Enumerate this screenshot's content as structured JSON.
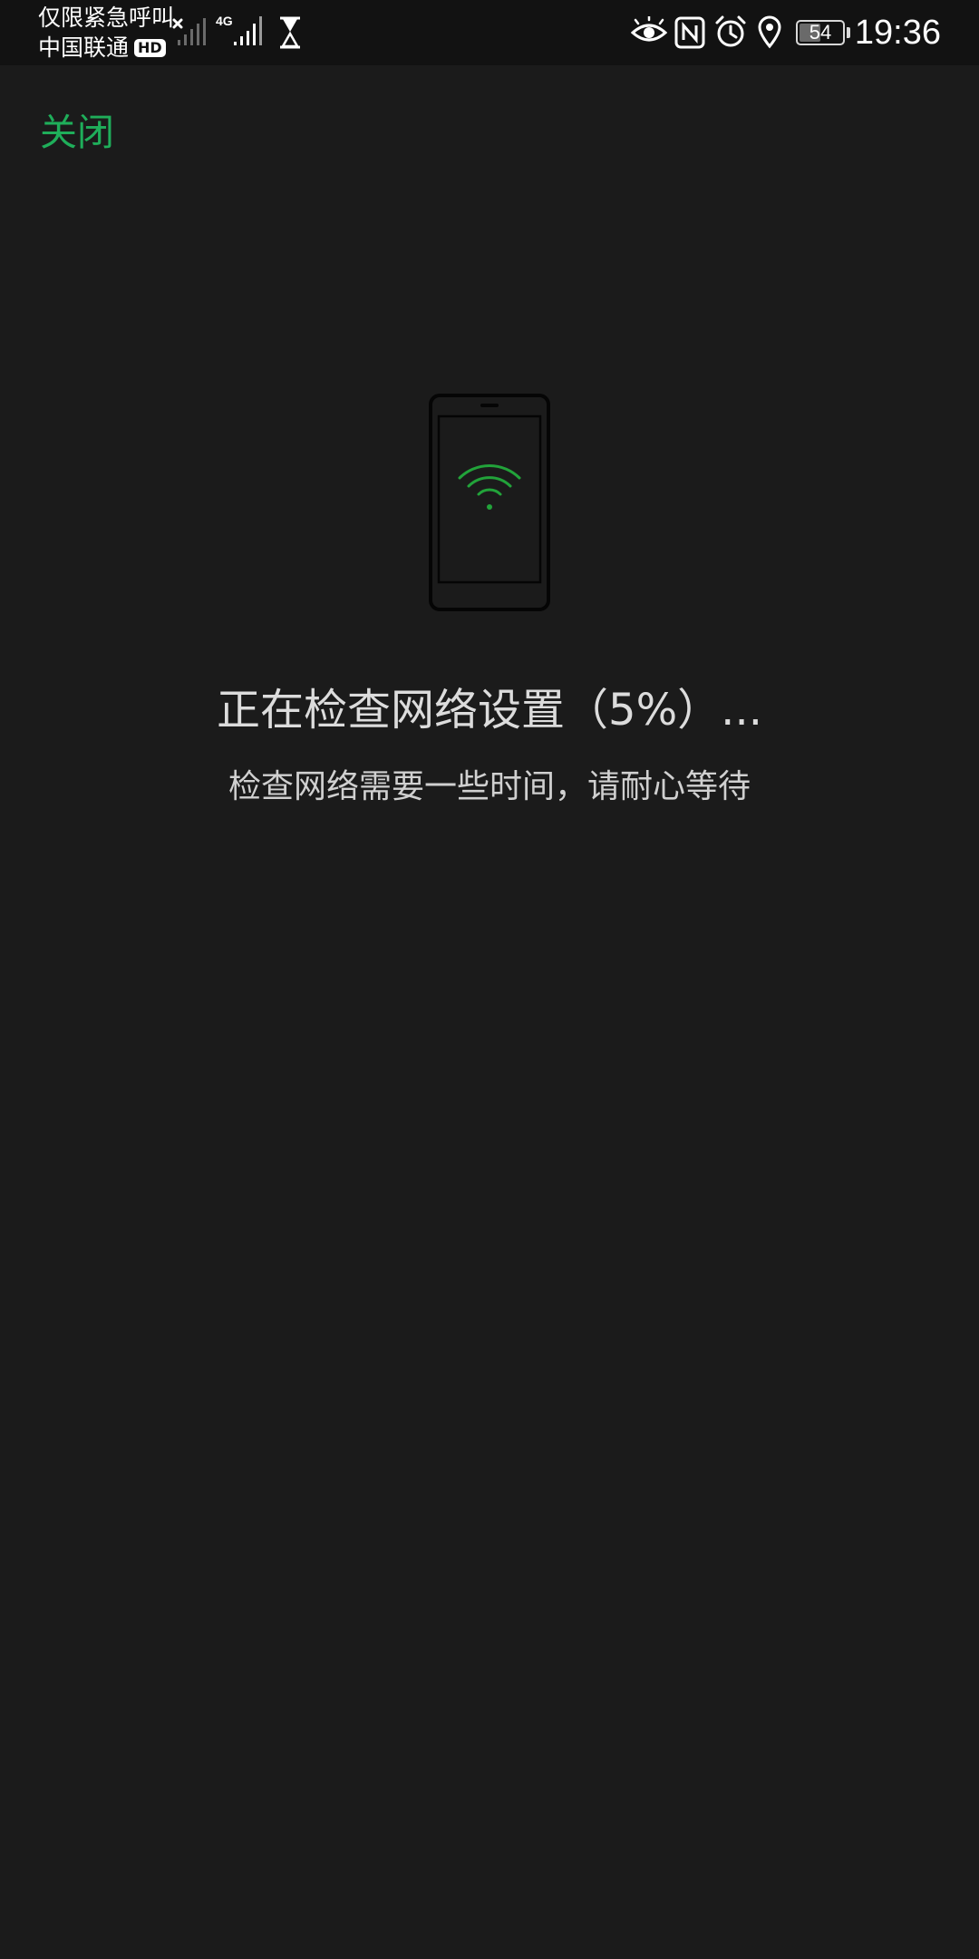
{
  "status_bar": {
    "carrier_line1": "仅限紧急呼叫",
    "carrier_line2": "中国联通",
    "hd_badge": "HD",
    "network_type": "4G",
    "battery_level": "54",
    "battery_fraction": 0.54,
    "time": "19:36",
    "icons": [
      "signal-x-icon",
      "signal-4g-icon",
      "hourglass-icon",
      "eye-icon",
      "nfc-icon",
      "alarm-icon",
      "location-icon",
      "battery-icon"
    ]
  },
  "toolbar": {
    "close_label": "关闭"
  },
  "main": {
    "illustration": "phone-wifi-icon",
    "title": "正在检查网络设置（5%）...",
    "subtitle": "检查网络需要一些时间，请耐心等待"
  },
  "colors": {
    "background": "#1b1b1b",
    "status_bar": "#121212",
    "accent": "#1fae5a",
    "wifi_green": "#22a33a"
  }
}
